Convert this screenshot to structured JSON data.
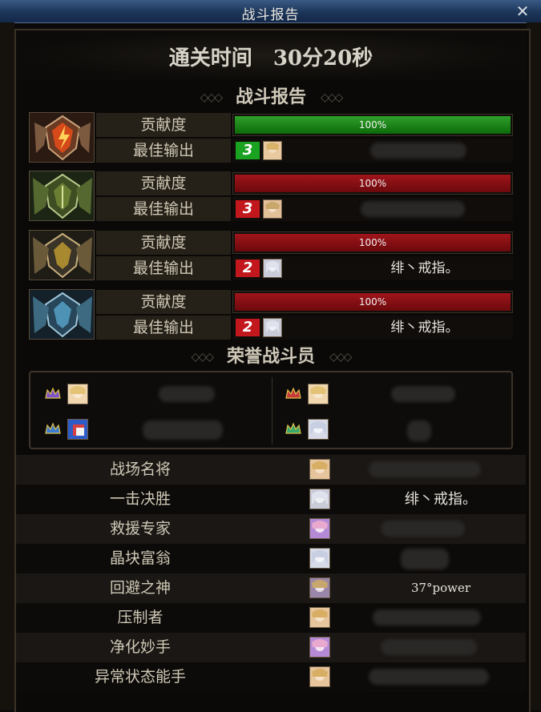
{
  "window": {
    "title": "战斗报告",
    "close_label": "✕"
  },
  "clear_time": {
    "label": "通关时间",
    "value": "30分20秒"
  },
  "section_battle": "战斗报告",
  "contribution_label": "贡献度",
  "best_output_label": "最佳输出",
  "panels": [
    {
      "contribution": "100%",
      "contribution_fraction": 1.0,
      "bar_color": "#1e8a1b",
      "rank": "3",
      "rank_color": "#1aa321",
      "player_name": ""
    },
    {
      "contribution": "100%",
      "contribution_fraction": 1.0,
      "bar_color": "#a0151b",
      "rank": "3",
      "rank_color": "#c2171c",
      "player_name": ""
    },
    {
      "contribution": "100%",
      "contribution_fraction": 1.0,
      "bar_color": "#a0151b",
      "rank": "2",
      "rank_color": "#c2171c",
      "player_name": "绯丶戒指。"
    },
    {
      "contribution": "100%",
      "contribution_fraction": 1.0,
      "bar_color": "#a0151b",
      "rank": "2",
      "rank_color": "#c2171c",
      "player_name": "绯丶戒指。"
    }
  ],
  "section_honor": "荣誉战斗员",
  "honor_players": [
    {
      "icon": "crown-icon",
      "name": ""
    },
    {
      "icon": "crown-icon",
      "name": ""
    },
    {
      "icon": "crown-icon",
      "name": ""
    },
    {
      "icon": "crown-icon",
      "name": ""
    }
  ],
  "awards": [
    {
      "title": "战场名将",
      "player": ""
    },
    {
      "title": "一击决胜",
      "player": "绯丶戒指。"
    },
    {
      "title": "救援专家",
      "player": ""
    },
    {
      "title": "晶块富翁",
      "player": ""
    },
    {
      "title": "回避之神",
      "player": "37°power"
    },
    {
      "title": "压制者",
      "player": ""
    },
    {
      "title": "净化妙手",
      "player": ""
    },
    {
      "title": "异常状态能手",
      "player": ""
    }
  ]
}
